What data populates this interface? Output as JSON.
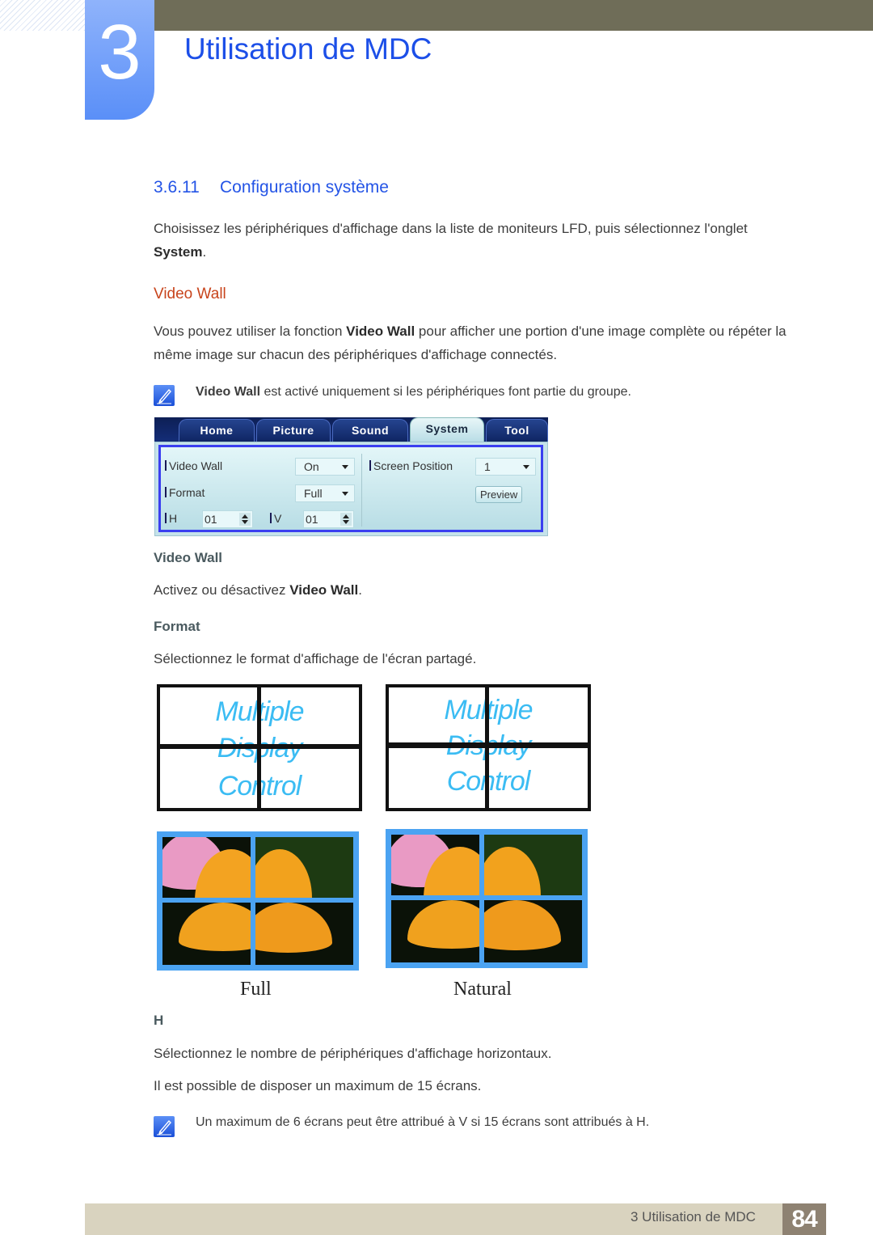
{
  "header": {
    "chapter_number": "3",
    "chapter_title": "Utilisation de MDC"
  },
  "section": {
    "number": "3.6.11",
    "title": "Configuration système"
  },
  "intro": {
    "text": "Choisissez les périphériques d'affichage dans la liste de moniteurs LFD, puis sélectionnez l'onglet",
    "bold": "System",
    "end": "."
  },
  "video_wall": {
    "heading": "Video Wall",
    "para_pre": "Vous pouvez utiliser la fonction ",
    "para_bold": "Video Wall",
    "para_post_line1": " pour afficher une portion d'une image complète ou répéter la",
    "para_line2": "même image sur chacun des périphériques d'affichage connectés.",
    "note_bold": "Video Wall",
    "note_text": " est activé uniquement si les périphériques font partie du groupe."
  },
  "mdc_ui": {
    "tabs": [
      {
        "label": "Home",
        "active": false
      },
      {
        "label": "Picture",
        "active": false
      },
      {
        "label": "Sound",
        "active": false
      },
      {
        "label": "System",
        "active": true
      },
      {
        "label": "Tool",
        "active": false
      }
    ],
    "video_wall_label": "Video Wall",
    "video_wall_value": "On",
    "format_label": "Format",
    "format_value": "Full",
    "h_label": "H",
    "h_value": "01",
    "v_label": "V",
    "v_value": "01",
    "screen_position_label": "Screen Position",
    "screen_position_value": "1",
    "preview_button": "Preview"
  },
  "desc_video_wall": {
    "heading": "Video Wall",
    "pre": "Activez ou désactivez ",
    "bold": "Video Wall",
    "end": "."
  },
  "desc_format": {
    "heading": "Format",
    "text": "Sélectionnez le format d'affichage de l'écran partagé."
  },
  "illustration": {
    "word1": "Multiple",
    "word2": "Display",
    "word3": "Control",
    "caption_full": "Full",
    "caption_natural": "Natural"
  },
  "desc_h": {
    "heading": "H",
    "line1": "Sélectionnez le nombre de périphériques d'affichage horizontaux.",
    "line2": "Il est possible de disposer un maximum de 15 écrans.",
    "note": "Un maximum de 6 écrans peut être attribué à V si 15 écrans sont attribués à H."
  },
  "footer": {
    "chapter_label": "3 Utilisation de MDC",
    "page_number": "84"
  }
}
